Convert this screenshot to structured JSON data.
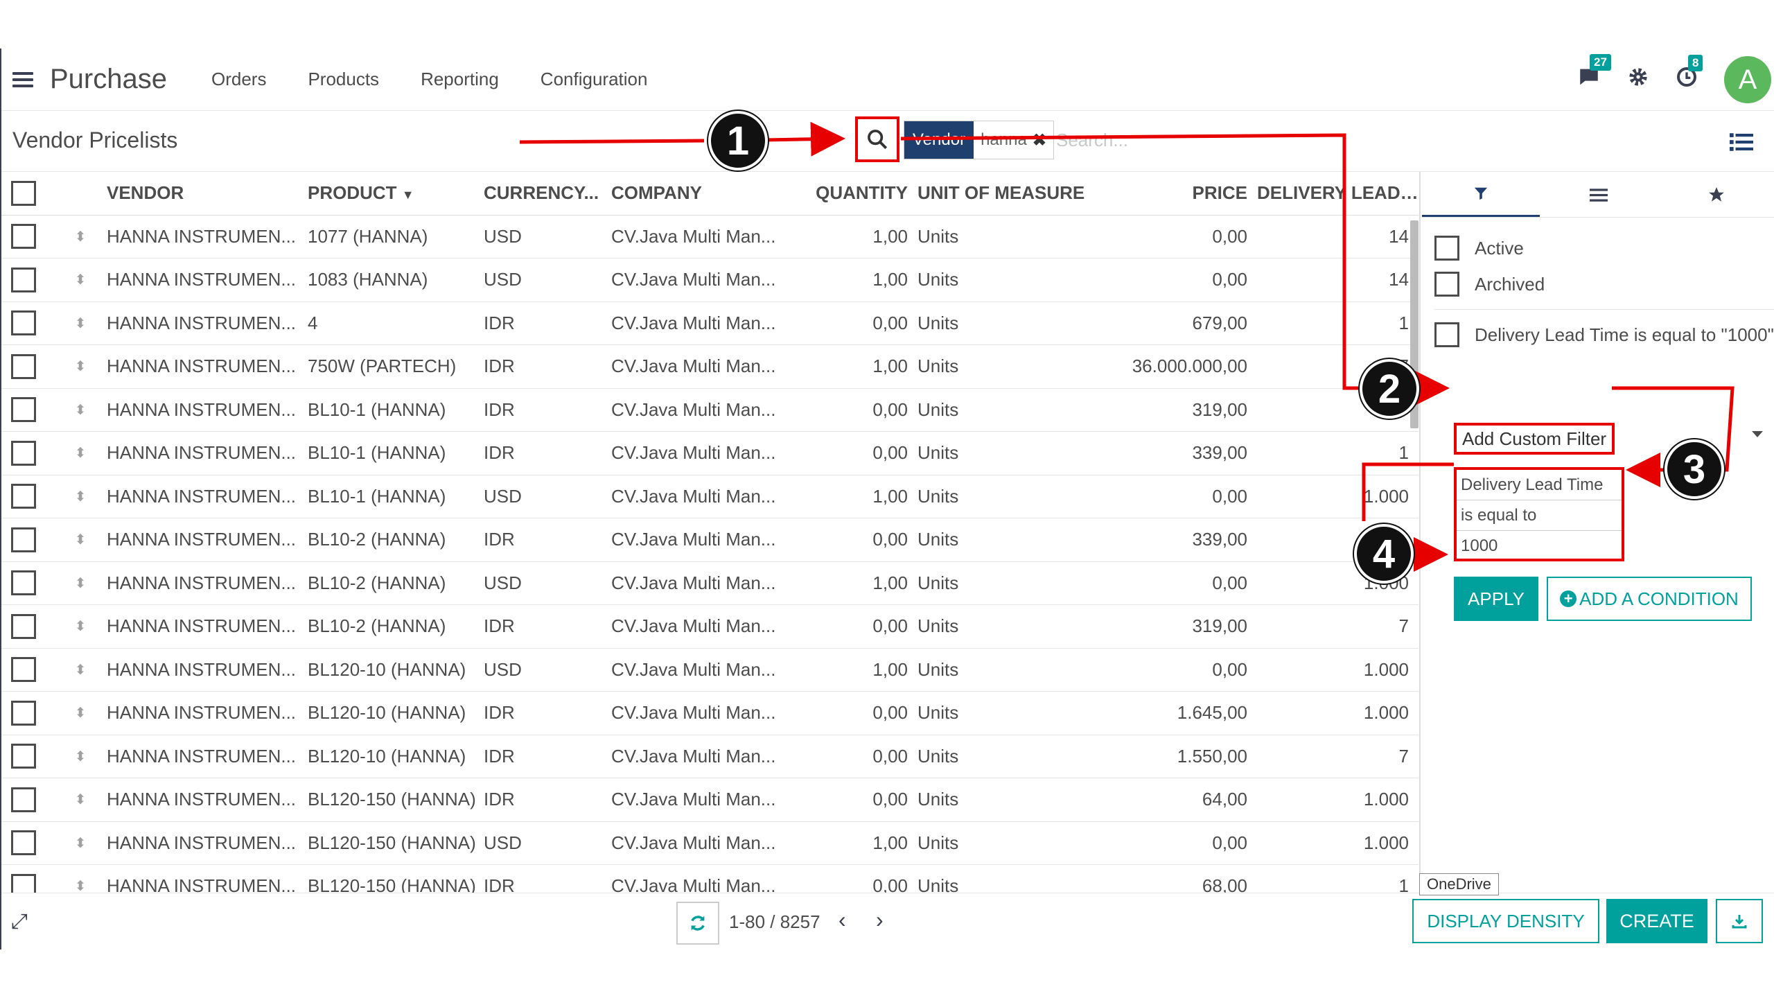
{
  "nav": {
    "app_name": "Purchase",
    "menu": [
      "Orders",
      "Products",
      "Reporting",
      "Configuration"
    ],
    "chat_badge": "27",
    "activity_badge": "8",
    "avatar_letter": "A"
  },
  "control_panel": {
    "title": "Vendor Pricelists",
    "facet_label": "Vendor",
    "facet_value": "hanna",
    "search_placeholder": "Search..."
  },
  "table": {
    "headers": [
      "VENDOR",
      "PRODUCT",
      "CURRENCY...",
      "COMPANY",
      "QUANTITY",
      "UNIT OF MEASURE",
      "PRICE",
      "DELIVERY LEAD T..."
    ],
    "rows": [
      {
        "vendor": "HANNA INSTRUMEN...",
        "product": "1077 (HANNA)",
        "currency": "USD",
        "company": "CV.Java Multi Man...",
        "quantity": "1,00",
        "uom": "Units",
        "price": "0,00",
        "lead": "14"
      },
      {
        "vendor": "HANNA INSTRUMEN...",
        "product": "1083 (HANNA)",
        "currency": "USD",
        "company": "CV.Java Multi Man...",
        "quantity": "1,00",
        "uom": "Units",
        "price": "0,00",
        "lead": "14"
      },
      {
        "vendor": "HANNA INSTRUMEN...",
        "product": "4",
        "currency": "IDR",
        "company": "CV.Java Multi Man...",
        "quantity": "0,00",
        "uom": "Units",
        "price": "679,00",
        "lead": "1"
      },
      {
        "vendor": "HANNA INSTRUMEN...",
        "product": "750W (PARTECH)",
        "currency": "IDR",
        "company": "CV.Java Multi Man...",
        "quantity": "1,00",
        "uom": "Units",
        "price": "36.000.000,00",
        "lead": "7"
      },
      {
        "vendor": "HANNA INSTRUMEN...",
        "product": "BL10-1 (HANNA)",
        "currency": "IDR",
        "company": "CV.Java Multi Man...",
        "quantity": "0,00",
        "uom": "Units",
        "price": "319,00",
        "lead": ""
      },
      {
        "vendor": "HANNA INSTRUMEN...",
        "product": "BL10-1 (HANNA)",
        "currency": "IDR",
        "company": "CV.Java Multi Man...",
        "quantity": "0,00",
        "uom": "Units",
        "price": "339,00",
        "lead": "1"
      },
      {
        "vendor": "HANNA INSTRUMEN...",
        "product": "BL10-1 (HANNA)",
        "currency": "USD",
        "company": "CV.Java Multi Man...",
        "quantity": "1,00",
        "uom": "Units",
        "price": "0,00",
        "lead": "1.000"
      },
      {
        "vendor": "HANNA INSTRUMEN...",
        "product": "BL10-2 (HANNA)",
        "currency": "IDR",
        "company": "CV.Java Multi Man...",
        "quantity": "0,00",
        "uom": "Units",
        "price": "339,00",
        "lead": ""
      },
      {
        "vendor": "HANNA INSTRUMEN...",
        "product": "BL10-2 (HANNA)",
        "currency": "USD",
        "company": "CV.Java Multi Man...",
        "quantity": "1,00",
        "uom": "Units",
        "price": "0,00",
        "lead": "1.000"
      },
      {
        "vendor": "HANNA INSTRUMEN...",
        "product": "BL10-2 (HANNA)",
        "currency": "IDR",
        "company": "CV.Java Multi Man...",
        "quantity": "0,00",
        "uom": "Units",
        "price": "319,00",
        "lead": "7"
      },
      {
        "vendor": "HANNA INSTRUMEN...",
        "product": "BL120-10 (HANNA)",
        "currency": "USD",
        "company": "CV.Java Multi Man...",
        "quantity": "1,00",
        "uom": "Units",
        "price": "0,00",
        "lead": "1.000"
      },
      {
        "vendor": "HANNA INSTRUMEN...",
        "product": "BL120-10 (HANNA)",
        "currency": "IDR",
        "company": "CV.Java Multi Man...",
        "quantity": "0,00",
        "uom": "Units",
        "price": "1.645,00",
        "lead": "1.000"
      },
      {
        "vendor": "HANNA INSTRUMEN...",
        "product": "BL120-10 (HANNA)",
        "currency": "IDR",
        "company": "CV.Java Multi Man...",
        "quantity": "0,00",
        "uom": "Units",
        "price": "1.550,00",
        "lead": "7"
      },
      {
        "vendor": "HANNA INSTRUMEN...",
        "product": "BL120-150 (HANNA)",
        "currency": "IDR",
        "company": "CV.Java Multi Man...",
        "quantity": "0,00",
        "uom": "Units",
        "price": "64,00",
        "lead": "1.000"
      },
      {
        "vendor": "HANNA INSTRUMEN...",
        "product": "BL120-150 (HANNA)",
        "currency": "USD",
        "company": "CV.Java Multi Man...",
        "quantity": "1,00",
        "uom": "Units",
        "price": "0,00",
        "lead": "1.000"
      },
      {
        "vendor": "HANNA INSTRUMEN...",
        "product": "BL120-150 (HANNA)",
        "currency": "IDR",
        "company": "CV.Java Multi Man...",
        "quantity": "0,00",
        "uom": "Units",
        "price": "68,00",
        "lead": "1"
      }
    ]
  },
  "filters": {
    "options": [
      "Active",
      "Archived"
    ],
    "custom_option": "Delivery Lead Time is equal to \"1000\"",
    "add_custom": "Add Custom Filter",
    "condition_field": "Delivery Lead Time",
    "condition_operator": "is equal to",
    "condition_value": "1000",
    "apply": "APPLY",
    "add_condition": "ADD A CONDITION"
  },
  "footer": {
    "pager": "1-80 / 8257",
    "display_density": "DISPLAY DENSITY",
    "create": "CREATE",
    "tooltip": "OneDrive"
  },
  "annotations": [
    "1",
    "2",
    "3",
    "4"
  ],
  "colors": {
    "accent": "#00a09d",
    "annotation": "#e60000",
    "facet": "#1f3f6e"
  }
}
